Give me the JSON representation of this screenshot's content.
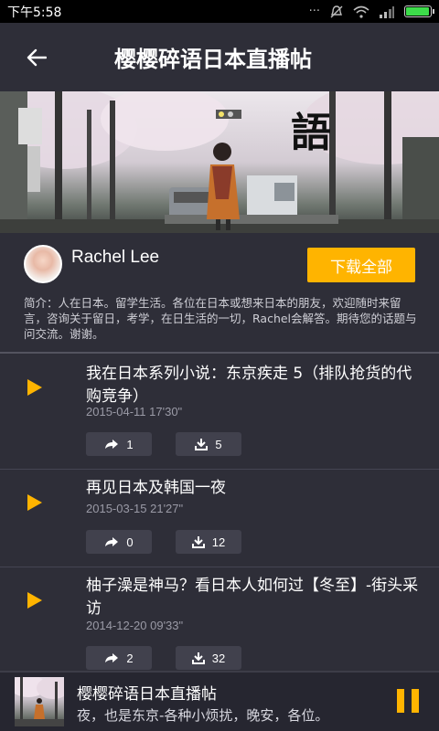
{
  "status_bar": {
    "time": "下午5:58",
    "icons": [
      "dots-icon",
      "mute-icon",
      "wifi-icon",
      "signal-icon",
      "battery-icon"
    ],
    "battery_fill": 0.95,
    "battery_color": "#3ddc4a"
  },
  "header": {
    "back_icon": "arrow-left-icon",
    "title": "樱樱碎语日本直播帖"
  },
  "banner": {
    "logo_text": "語"
  },
  "profile": {
    "name": "Rachel Lee",
    "download_all_label": "下载全部",
    "intro": "简介：人在日本。留学生活。各位在日本或想来日本的朋友，欢迎随时来留言，咨询关于留日，考学，在日生活的一切，Rachel会解答。期待您的话题与问交流。谢谢。"
  },
  "episodes": [
    {
      "title": "我在日本系列小说：东京疾走 5（排队抢货的代购竞争）",
      "date": "2015-04-11  17'30\"",
      "shares": "1",
      "downloads": "5"
    },
    {
      "title": "再见日本及韩国一夜",
      "date": "2015-03-15  21'27\"",
      "shares": "0",
      "downloads": "12"
    },
    {
      "title": "柚子澡是神马？看日本人如何过【冬至】-街头采访",
      "date": "2014-12-20  09'33\"",
      "shares": "2",
      "downloads": "32"
    }
  ],
  "player": {
    "title": "樱樱碎语日本直播帖",
    "subtitle": "夜，也是东京-各种小烦扰，晚安，各位。",
    "pause_icon": "pause-icon"
  },
  "colors": {
    "accent": "#ffb400",
    "background": "#2e2e38"
  }
}
